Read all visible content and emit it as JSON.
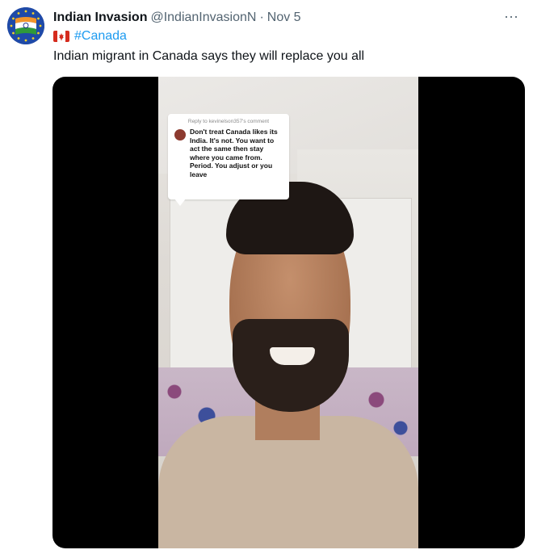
{
  "user": {
    "display_name": "Indian Invasion",
    "handle": "@IndianInvasionN",
    "separator": "·",
    "date": "Nov 5",
    "avatar_icon": "india-flag-eu-stars-avatar"
  },
  "more_label": "···",
  "hashtag": {
    "flag_icon": "canada-flag-icon",
    "text": "#Canada"
  },
  "tweet_text": "Indian migrant in Canada says they will replace you all",
  "media": {
    "type": "video",
    "reply_card": {
      "meta": "Reply to kevinelson357's comment",
      "body": "Don't treat Canada likes its India. It's not. You want to act the same then stay where you came from. Period. You adjust or you leave"
    }
  },
  "colors": {
    "text_primary": "#0f1419",
    "text_secondary": "#536471",
    "link": "#1d9bf0",
    "media_bg": "#000000"
  }
}
